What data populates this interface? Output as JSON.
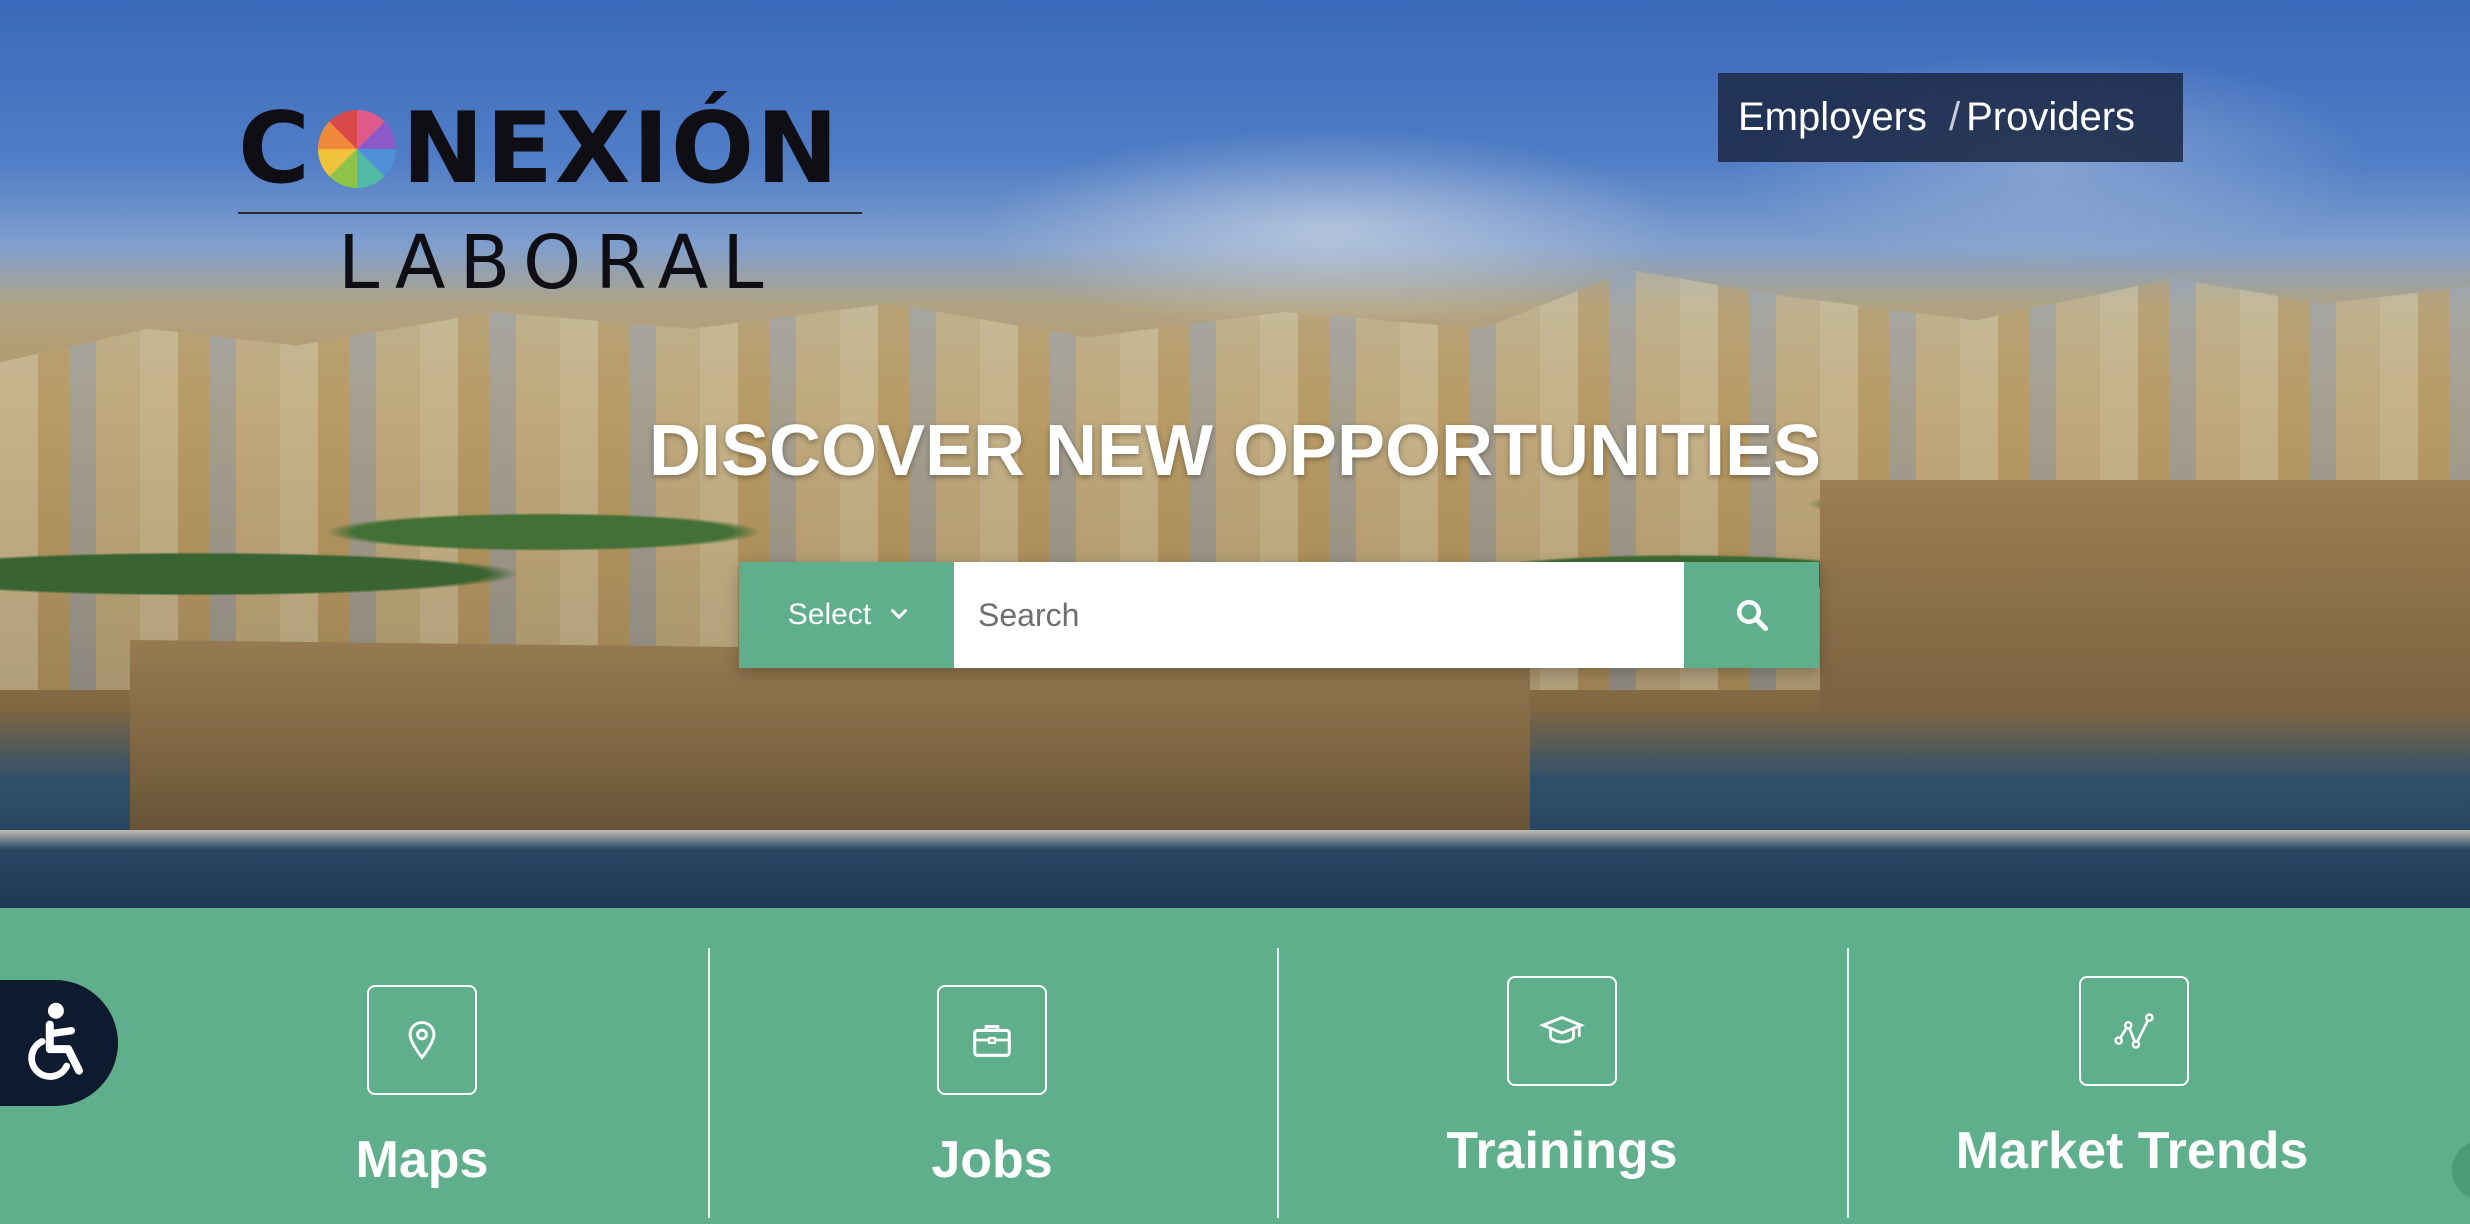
{
  "brand": {
    "logo_top_left": "C",
    "logo_top_right": "NEXIÓN",
    "logo_bottom": "LABORAL"
  },
  "topnav": {
    "employers_label": "Employers",
    "separator": "/",
    "providers_label": "Providers"
  },
  "hero": {
    "headline": "DISCOVER NEW OPPORTUNITIES"
  },
  "search": {
    "select_label": "Select",
    "placeholder": "Search",
    "button_icon": "search-icon"
  },
  "categories": [
    {
      "label": "Maps",
      "icon": "map-pin-icon"
    },
    {
      "label": "Jobs",
      "icon": "briefcase-icon"
    },
    {
      "label": "Trainings",
      "icon": "graduation-cap-icon"
    },
    {
      "label": "Market Trends",
      "icon": "trend-line-icon"
    }
  ],
  "accessibility": {
    "icon": "accessibility-icon"
  },
  "colors": {
    "accent_green": "#5fae8c",
    "nav_dark": "#1c2a48",
    "a11y_dark": "#0e1a2e"
  }
}
